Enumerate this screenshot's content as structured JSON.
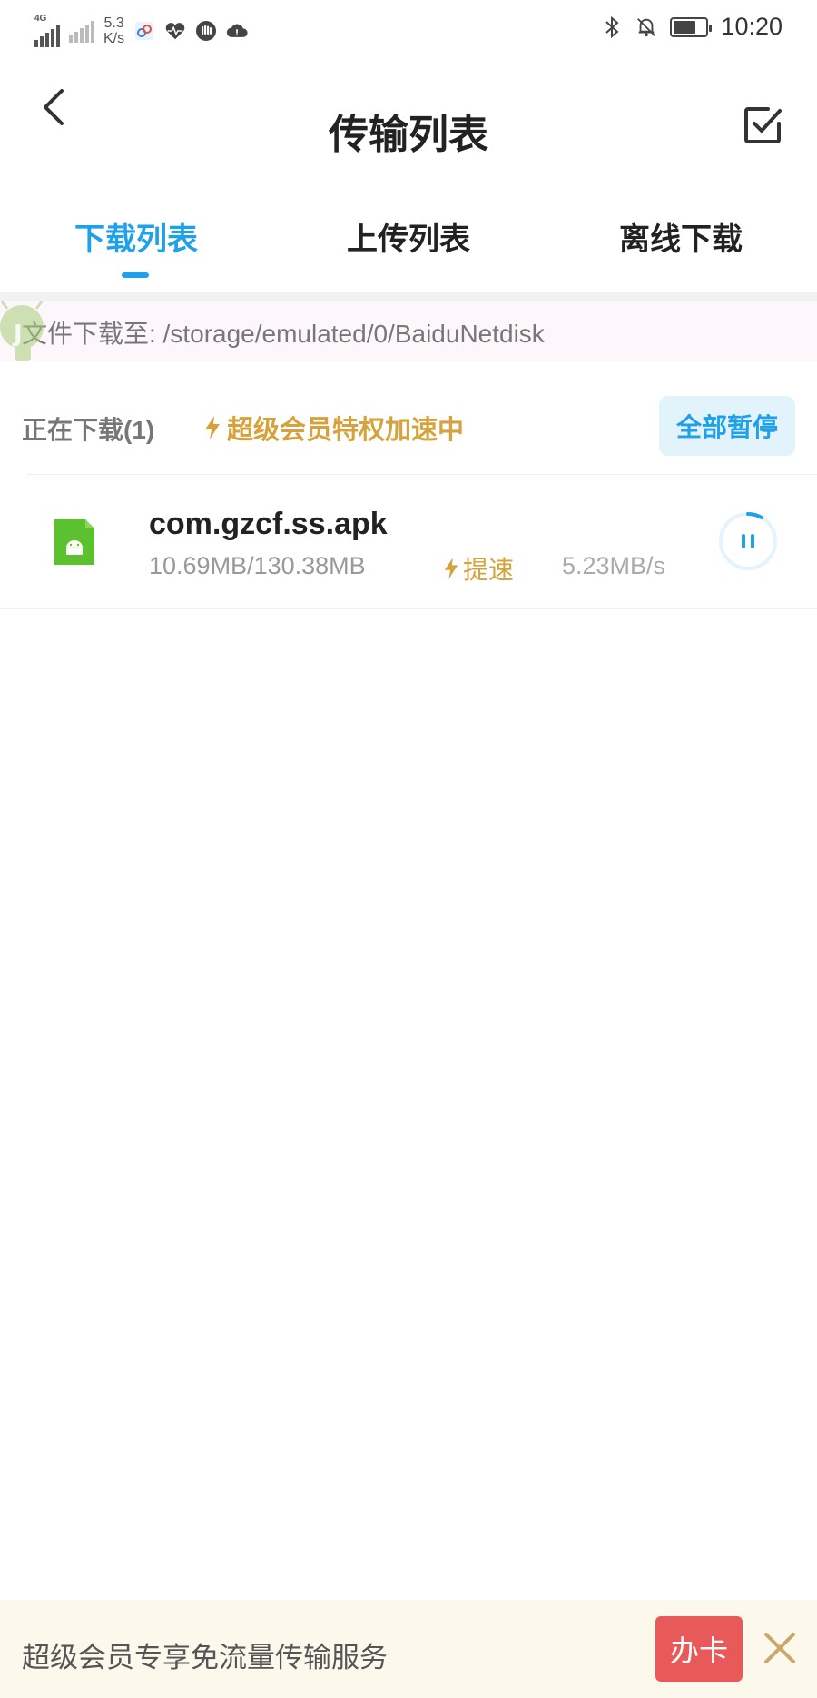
{
  "status_bar": {
    "network_label": "4G",
    "speed_value": "5.3",
    "speed_unit": "K/s",
    "time": "10:20",
    "battery_percent": 70,
    "icons": [
      "signal-icon",
      "no-sim-signal-icon",
      "app-notify-icon",
      "health-icon",
      "hand-icon",
      "cloud-icon",
      "bluetooth-icon",
      "mute-bell-icon",
      "battery-icon"
    ]
  },
  "header": {
    "title": "传输列表",
    "back_icon": "chevron-left-icon",
    "edit_icon": "checkbox-edit-icon"
  },
  "tabs": [
    {
      "label": "下载列表",
      "active": true
    },
    {
      "label": "上传列表",
      "active": false
    },
    {
      "label": "离线下载",
      "active": false
    }
  ],
  "path_bar": {
    "text": "文件下载至: /storage/emulated/0/BaiduNetdisk"
  },
  "downloading": {
    "count_label": "正在下载(1)",
    "accel_label": "超级会员特权加速中",
    "pause_all_label": "全部暂停"
  },
  "files": [
    {
      "name": "com.gzcf.ss.apk",
      "size": "10.69MB/130.38MB",
      "boost_label": "提速",
      "rate": "5.23MB/s",
      "progress": 0.082,
      "icon": "android-file-icon"
    }
  ],
  "banner": {
    "text": "超级会员专享免流量传输服务",
    "button_label": "办卡"
  },
  "colors": {
    "accent": "#1ea0ea",
    "gold": "#d6a23c",
    "banner_button": "#e85a5a",
    "android_green": "#5cc12f"
  }
}
